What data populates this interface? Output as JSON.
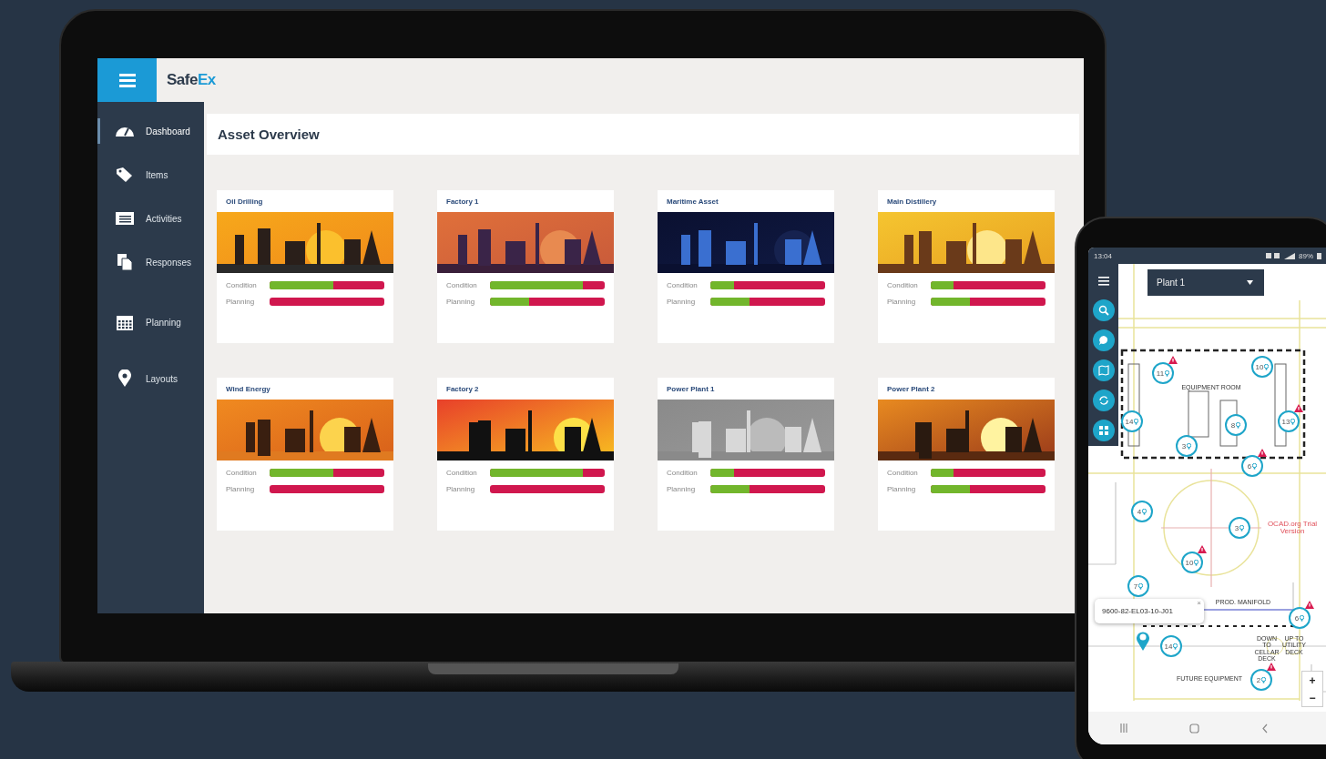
{
  "app": {
    "logo_main": "Safe",
    "logo_accent": "Ex",
    "page_title": "Asset Overview"
  },
  "sidebar": {
    "items": [
      {
        "label": "Dashboard",
        "selected": true
      },
      {
        "label": "Items",
        "selected": false
      },
      {
        "label": "Activities",
        "selected": false
      },
      {
        "label": "Responses",
        "selected": false
      },
      {
        "label": "Planning",
        "selected": false
      },
      {
        "label": "Layouts",
        "selected": false
      }
    ]
  },
  "assets": [
    {
      "title": "Oil Drilling",
      "kind": "picture",
      "bars": [
        {
          "label": "Condition",
          "level": 0.56
        },
        {
          "label": "Planning",
          "level": 0
        }
      ]
    },
    {
      "title": "Factory 1",
      "kind": "picture",
      "bars": [
        {
          "label": "Condition",
          "level": 0.81
        },
        {
          "label": "Planning",
          "level": 0.34
        }
      ]
    },
    {
      "title": "Maritime Asset",
      "kind": "picture",
      "bars": [
        {
          "label": "Condition",
          "level": 0.21
        },
        {
          "label": "Planning",
          "level": 0.34
        }
      ]
    },
    {
      "title": "Main Distillery",
      "kind": "picture",
      "bars": [
        {
          "label": "Condition",
          "level": 0.2
        },
        {
          "label": "Planning",
          "level": 0.34
        }
      ]
    },
    {
      "title": "Wind Energy",
      "kind": "picture",
      "bars": [
        {
          "label": "Condition",
          "level": 0.56
        },
        {
          "label": "Planning",
          "level": 0
        }
      ]
    },
    {
      "title": "Factory 2",
      "kind": "picture",
      "bars": [
        {
          "label": "Condition",
          "level": 0.81
        },
        {
          "label": "Planning",
          "level": 0
        }
      ]
    },
    {
      "title": "Power Plant 1",
      "kind": "picture",
      "bars": [
        {
          "label": "Condition",
          "level": 0.21
        },
        {
          "label": "Planning",
          "level": 0.34
        }
      ]
    },
    {
      "title": "Power Plant 2",
      "kind": "picture",
      "bars": [
        {
          "label": "Condition",
          "level": 0.2
        },
        {
          "label": "Planning",
          "level": 0.34
        }
      ]
    }
  ],
  "phone": {
    "status_bar": {
      "time": "13:04",
      "battery": "89%"
    },
    "dropdown": {
      "value": "Plant 1"
    },
    "plan_labels": [
      "EQUIPMENT ROOM",
      "OCAD.org Trial Version",
      "PROD. MANIFOLD",
      "FUTURE EQUIPMENT",
      "DOWN TO CELLAR DECK",
      "UP TO UTILITY DECK"
    ],
    "markers": [
      {
        "label": "11",
        "alert": true
      },
      {
        "label": "10",
        "alert": false
      },
      {
        "label": "14",
        "alert": false
      },
      {
        "label": "8",
        "alert": false
      },
      {
        "label": "13",
        "alert": true
      },
      {
        "label": "3",
        "alert": false
      },
      {
        "label": "6",
        "alert": true
      },
      {
        "label": "4",
        "alert": false
      },
      {
        "label": "3",
        "alert": false
      },
      {
        "label": "10",
        "alert": true
      },
      {
        "label": "7",
        "alert": false
      },
      {
        "label": "6",
        "alert": true
      },
      {
        "label": "14",
        "alert": false
      },
      {
        "label": "2",
        "alert": true
      }
    ],
    "popup": {
      "text": "9600-82-EL03-10-J01",
      "close": "×"
    },
    "zoom_controls": [
      "+",
      "−"
    ]
  }
}
